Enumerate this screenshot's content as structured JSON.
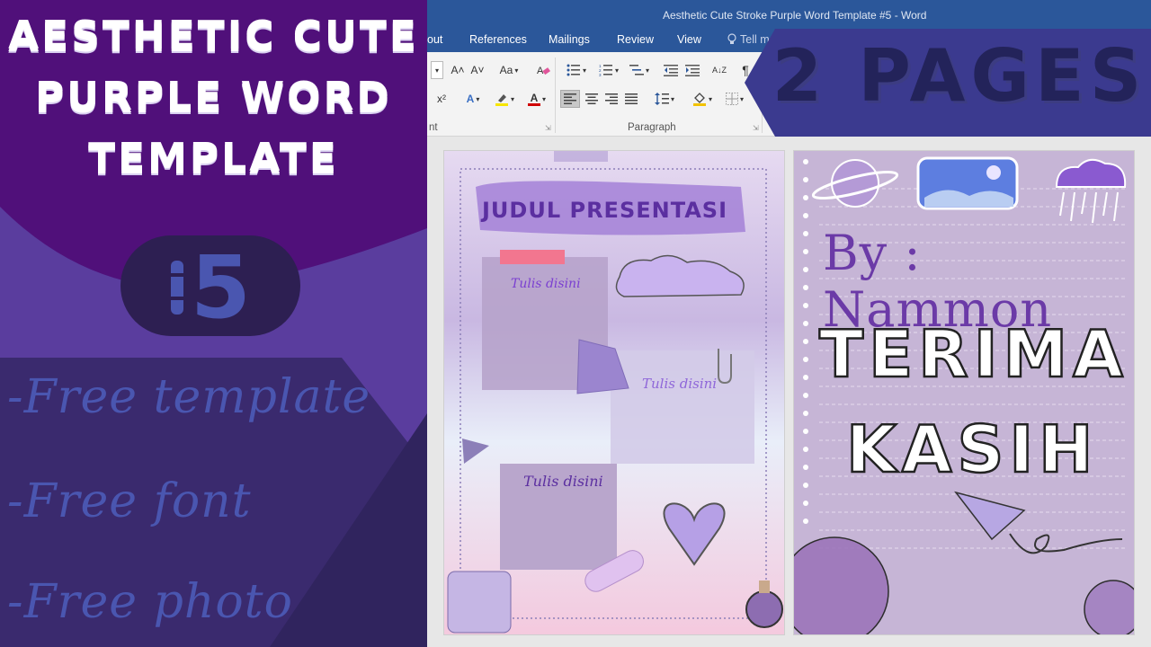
{
  "window": {
    "title": "Aesthetic Cute Stroke Purple Word Template #5 - Word"
  },
  "menu": {
    "tabs": [
      "out",
      "References",
      "Mailings",
      "Review",
      "View"
    ],
    "tell_me": "Tell me"
  },
  "ribbon": {
    "font_group_label": "nt",
    "paragraph_group_label": "Paragraph",
    "grow_font": "A˄",
    "shrink_font": "A˅",
    "change_case": "Aa",
    "superscript": "x²",
    "text_effects": "A",
    "font_color": "A",
    "sort": "A↓Z",
    "show_marks": "¶"
  },
  "promo": {
    "title_lines": [
      "AESTHETIC CUTE",
      "PURPLE WORD",
      "TEMPLATE"
    ],
    "number": "5",
    "bullets": [
      "-Free template",
      "-Free font",
      "-Free photo"
    ],
    "banner": "2 PAGES"
  },
  "page1": {
    "title": "JUDUL PRESENTASI",
    "note1": "Tulis disini",
    "note2": "Tulis disini",
    "note3": "Tulis disini"
  },
  "page2": {
    "byline": "By : Nammon",
    "thanks_line1": "TERIMA",
    "thanks_line2": "KASIH"
  },
  "colors": {
    "word_blue": "#2b579a",
    "promo_purple": "#5a3d9e",
    "promo_dark": "#3a2370",
    "banner_blue": "#3b3a8f",
    "text_purple": "#7b3fd1"
  }
}
